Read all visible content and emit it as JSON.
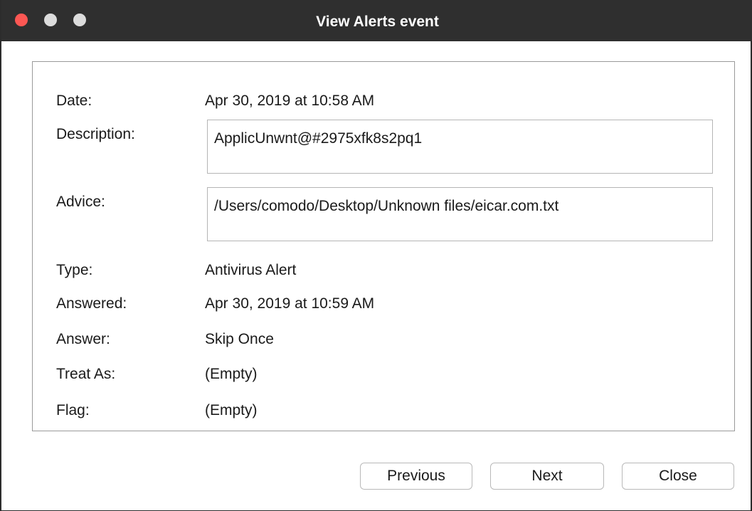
{
  "window": {
    "title": "View Alerts event"
  },
  "details": {
    "date_label": "Date:",
    "date_value": "Apr 30, 2019 at 10:58 AM",
    "description_label": "Description:",
    "description_value": "ApplicUnwnt@#2975xfk8s2pq1",
    "advice_label": "Advice:",
    "advice_value": "/Users/comodo/Desktop/Unknown files/eicar.com.txt",
    "type_label": "Type:",
    "type_value": "Antivirus Alert",
    "answered_label": "Answered:",
    "answered_value": "Apr 30, 2019 at 10:59 AM",
    "answer_label": "Answer:",
    "answer_value": "Skip Once",
    "treat_as_label": "Treat As:",
    "treat_as_value": "(Empty)",
    "flag_label": "Flag:",
    "flag_value": "(Empty)"
  },
  "buttons": {
    "previous": "Previous",
    "next": "Next",
    "close": "Close"
  },
  "colors": {
    "titlebar": "#2f2f2f",
    "close_light": "#fc5753",
    "inactive_light": "#dcdcdc"
  }
}
